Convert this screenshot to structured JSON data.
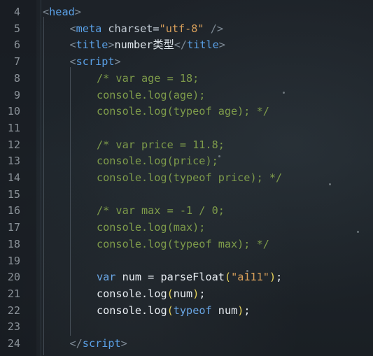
{
  "editor": {
    "lines": [
      {
        "number": "4",
        "indent": 0,
        "tokens": [
          {
            "t": "<",
            "k": "bracket"
          },
          {
            "t": "head",
            "k": "tag"
          },
          {
            "t": ">",
            "k": "bracket"
          }
        ]
      },
      {
        "number": "5",
        "indent": 1,
        "tokens": [
          {
            "t": "<",
            "k": "bracket"
          },
          {
            "t": "meta",
            "k": "tag"
          },
          {
            "t": " ",
            "k": "text"
          },
          {
            "t": "charset",
            "k": "attr"
          },
          {
            "t": "=",
            "k": "eq"
          },
          {
            "t": "\"utf-8\"",
            "k": "str"
          },
          {
            "t": " />",
            "k": "bracket"
          }
        ]
      },
      {
        "number": "6",
        "indent": 1,
        "tokens": [
          {
            "t": "<",
            "k": "bracket"
          },
          {
            "t": "title",
            "k": "tag"
          },
          {
            "t": ">",
            "k": "bracket"
          },
          {
            "t": "number类型",
            "k": "text"
          },
          {
            "t": "</",
            "k": "bracket"
          },
          {
            "t": "title",
            "k": "tag"
          },
          {
            "t": ">",
            "k": "bracket"
          }
        ]
      },
      {
        "number": "7",
        "indent": 1,
        "tokens": [
          {
            "t": "<",
            "k": "bracket"
          },
          {
            "t": "script",
            "k": "tag"
          },
          {
            "t": ">",
            "k": "bracket"
          }
        ]
      },
      {
        "number": "8",
        "indent": 2,
        "tokens": [
          {
            "t": "/* var age = 18;",
            "k": "comment"
          }
        ]
      },
      {
        "number": "9",
        "indent": 2,
        "tokens": [
          {
            "t": "console.log(age);",
            "k": "comment"
          }
        ]
      },
      {
        "number": "10",
        "indent": 2,
        "tokens": [
          {
            "t": "console.log(typeof age); */",
            "k": "comment"
          }
        ]
      },
      {
        "number": "11",
        "indent": 2,
        "tokens": []
      },
      {
        "number": "12",
        "indent": 2,
        "tokens": [
          {
            "t": "/* var price = 11.8;",
            "k": "comment"
          }
        ]
      },
      {
        "number": "13",
        "indent": 2,
        "tokens": [
          {
            "t": "console.log(price);",
            "k": "comment"
          }
        ]
      },
      {
        "number": "14",
        "indent": 2,
        "tokens": [
          {
            "t": "console.log(typeof price); */",
            "k": "comment"
          }
        ]
      },
      {
        "number": "15",
        "indent": 2,
        "tokens": []
      },
      {
        "number": "16",
        "indent": 2,
        "tokens": [
          {
            "t": "/* var max = -1 / 0;",
            "k": "comment"
          }
        ]
      },
      {
        "number": "17",
        "indent": 2,
        "tokens": [
          {
            "t": "console.log(max);",
            "k": "comment"
          }
        ]
      },
      {
        "number": "18",
        "indent": 2,
        "tokens": [
          {
            "t": "console.log(typeof max); */",
            "k": "comment"
          }
        ]
      },
      {
        "number": "19",
        "indent": 2,
        "tokens": []
      },
      {
        "number": "20",
        "indent": 2,
        "tokens": [
          {
            "t": "var",
            "k": "kw"
          },
          {
            "t": " ",
            "k": "text"
          },
          {
            "t": "num",
            "k": "ident"
          },
          {
            "t": " = ",
            "k": "op"
          },
          {
            "t": "parseFloat",
            "k": "ident"
          },
          {
            "t": "(",
            "k": "paren"
          },
          {
            "t": "\"a111\"",
            "k": "str"
          },
          {
            "t": ")",
            "k": "paren"
          },
          {
            "t": ";",
            "k": "punct"
          }
        ]
      },
      {
        "number": "21",
        "indent": 2,
        "tokens": [
          {
            "t": "console",
            "k": "ident"
          },
          {
            "t": ".",
            "k": "punct"
          },
          {
            "t": "log",
            "k": "ident"
          },
          {
            "t": "(",
            "k": "paren"
          },
          {
            "t": "num",
            "k": "ident"
          },
          {
            "t": ")",
            "k": "paren"
          },
          {
            "t": ";",
            "k": "punct"
          }
        ]
      },
      {
        "number": "22",
        "indent": 2,
        "tokens": [
          {
            "t": "console",
            "k": "ident"
          },
          {
            "t": ".",
            "k": "punct"
          },
          {
            "t": "log",
            "k": "ident"
          },
          {
            "t": "(",
            "k": "paren"
          },
          {
            "t": "typeof",
            "k": "kw"
          },
          {
            "t": " ",
            "k": "text"
          },
          {
            "t": "num",
            "k": "ident"
          },
          {
            "t": ")",
            "k": "paren"
          },
          {
            "t": ";",
            "k": "punct"
          }
        ]
      },
      {
        "number": "23",
        "indent": 2,
        "tokens": []
      },
      {
        "number": "24",
        "indent": 1,
        "tokens": [
          {
            "t": "</",
            "k": "bracket"
          },
          {
            "t": "script",
            "k": "tag"
          },
          {
            "t": ">",
            "k": "bracket"
          }
        ]
      }
    ]
  },
  "colors": {
    "background": "#1d2228",
    "tag": "#5aa0e6",
    "string": "#d89f5a",
    "comment": "#7e9b4a",
    "keyword": "#6aa7e6",
    "paren": "#e6d25a",
    "line_number": "#8a9198"
  }
}
